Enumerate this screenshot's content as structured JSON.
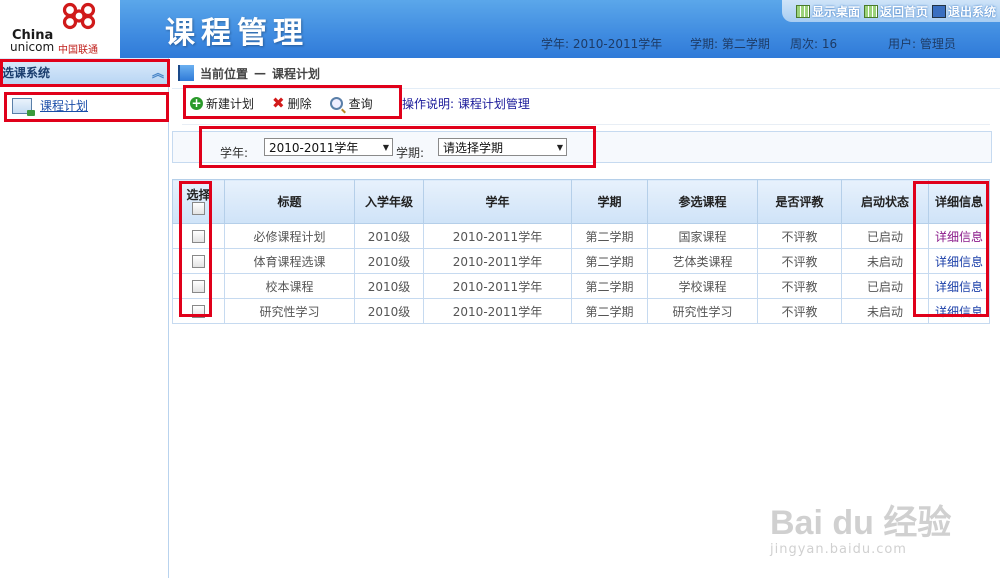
{
  "header": {
    "logo": {
      "en_line1": "China",
      "en_line2": "unicom",
      "cn": "中国联通"
    },
    "title": "课程管理",
    "links": [
      {
        "label": "显示桌面",
        "icon": "grid-icon"
      },
      {
        "label": "返回首页",
        "icon": "grid-icon"
      },
      {
        "label": "退出系统",
        "icon": "monitor-icon"
      }
    ],
    "info": {
      "year": "学年: 2010-2011学年",
      "term": "学期: 第二学期",
      "week": "周次: 16",
      "user": "用户: 管理员"
    }
  },
  "sidebar": {
    "section_title": "选课系统",
    "collapse_icon": "double-chevron-up-icon",
    "items": [
      {
        "label": "课程计划",
        "icon": "window-icon"
      }
    ]
  },
  "breadcrumb": {
    "label": "当前位置",
    "sep": "—",
    "current": "课程计划"
  },
  "toolbar": {
    "new_label": "新建计划",
    "delete_label": "删除",
    "query_label": "查询",
    "note": "操作说明: 课程计划管理"
  },
  "filter": {
    "year_label": "学年:",
    "year_value": "2010-2011学年",
    "term_label": "学期:",
    "term_value": "请选择学期"
  },
  "table": {
    "headers": [
      "选择",
      "标题",
      "入学年级",
      "学年",
      "学期",
      "参选课程",
      "是否评教",
      "启动状态",
      "详细信息"
    ],
    "rows": [
      {
        "title": "必修课程计划",
        "grade": "2010级",
        "year": "2010-2011学年",
        "term": "第二学期",
        "course": "国家课程",
        "eval": "不评教",
        "status": "已启动",
        "detail": "详细信息"
      },
      {
        "title": "体育课程选课",
        "grade": "2010级",
        "year": "2010-2011学年",
        "term": "第二学期",
        "course": "艺体类课程",
        "eval": "不评教",
        "status": "未启动",
        "detail": "详细信息"
      },
      {
        "title": "校本课程",
        "grade": "2010级",
        "year": "2010-2011学年",
        "term": "第二学期",
        "course": "学校课程",
        "eval": "不评教",
        "status": "已启动",
        "detail": "详细信息"
      },
      {
        "title": "研究性学习",
        "grade": "2010级",
        "year": "2010-2011学年",
        "term": "第二学期",
        "course": "研究性学习",
        "eval": "不评教",
        "status": "未启动",
        "detail": "详细信息"
      }
    ]
  },
  "colors": {
    "accent": "#3f8be0",
    "status_red": "#d01818",
    "annotation": "#e0001a"
  },
  "watermark": {
    "brand": "Bai du 经验",
    "url": "jingyan.baidu.com"
  }
}
